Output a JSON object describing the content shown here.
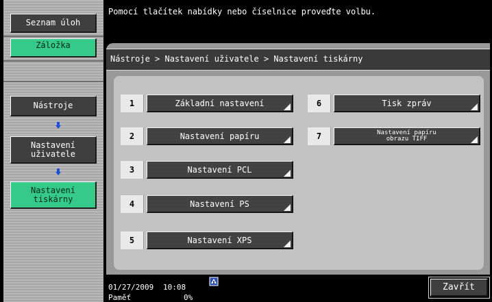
{
  "sidebar": {
    "job_list_label": "Seznam úloh",
    "bookmark_label": "Záložka",
    "steps": [
      "Nástroje",
      "Nastavení\nuživatele",
      "Nastavení\ntiskárny"
    ]
  },
  "message": "Pomocí tlačítek nabídky nebo číselnice proveďte volbu.",
  "breadcrumb": "Nástroje > Nastavení uživatele > Nastavení tiskárny",
  "menu": [
    {
      "num": "1",
      "label": "Základní nastavení"
    },
    {
      "num": "2",
      "label": "Nastavení papíru"
    },
    {
      "num": "3",
      "label": "Nastavení PCL"
    },
    {
      "num": "4",
      "label": "Nastavení PS"
    },
    {
      "num": "5",
      "label": "Nastavení XPS"
    },
    {
      "num": "6",
      "label": "Tisk zpráv"
    },
    {
      "num": "7",
      "label": "Nastavení papíru\nobrazu TIFF"
    }
  ],
  "footer": {
    "date": "01/27/2009",
    "time": "10:08",
    "memory_label": "Paměť",
    "memory_value": "0%",
    "close_label": "Zavřít"
  },
  "colors": {
    "accent_green": "#35c98a",
    "arrow_blue": "#1f4fd8"
  },
  "icons": {
    "step_arrow": "arrow-down-icon",
    "network": "network-status-icon"
  }
}
